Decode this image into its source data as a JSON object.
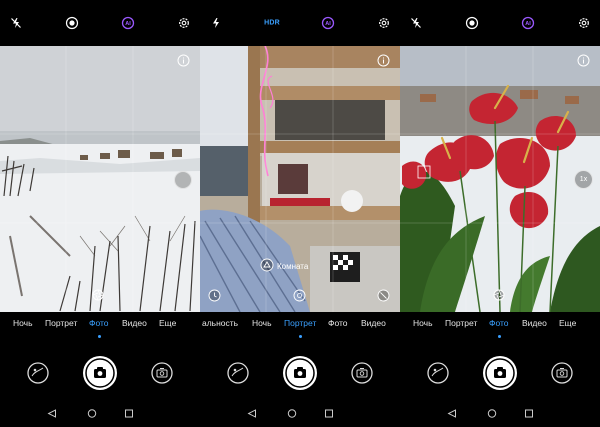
{
  "panels": [
    {
      "id": "p1",
      "top_icons": [
        "flash-off-icon",
        "live-photo-icon",
        "ai-icon",
        "settings-icon"
      ],
      "modes": [
        {
          "label": "Ночь",
          "active": false
        },
        {
          "label": "Портрет",
          "active": false
        },
        {
          "label": "Фото",
          "active": true
        },
        {
          "label": "Видео",
          "active": false
        },
        {
          "label": "Еще",
          "active": false
        }
      ]
    },
    {
      "id": "p2",
      "top_icons": [
        "flash-auto-icon",
        "hdr-label",
        "ai-icon",
        "settings-icon"
      ],
      "hdr_label": "HDR",
      "scene_label": "Комната",
      "modes": [
        {
          "label": "альность",
          "active": false
        },
        {
          "label": "Ночь",
          "active": false
        },
        {
          "label": "Портрет",
          "active": true
        },
        {
          "label": "Фото",
          "active": false
        },
        {
          "label": "Видео",
          "active": false
        }
      ]
    },
    {
      "id": "p3",
      "top_icons": [
        "flash-off-icon",
        "live-photo-icon",
        "ai-icon",
        "settings-icon"
      ],
      "zoom_label": "1x",
      "modes": [
        {
          "label": "Ночь",
          "active": false
        },
        {
          "label": "Портрет",
          "active": false
        },
        {
          "label": "Фото",
          "active": true
        },
        {
          "label": "Видео",
          "active": false
        },
        {
          "label": "Еще",
          "active": false
        }
      ]
    }
  ],
  "colors": {
    "accent": "#3aa0ff",
    "ai": "#9b59ff",
    "background": "#000000"
  }
}
